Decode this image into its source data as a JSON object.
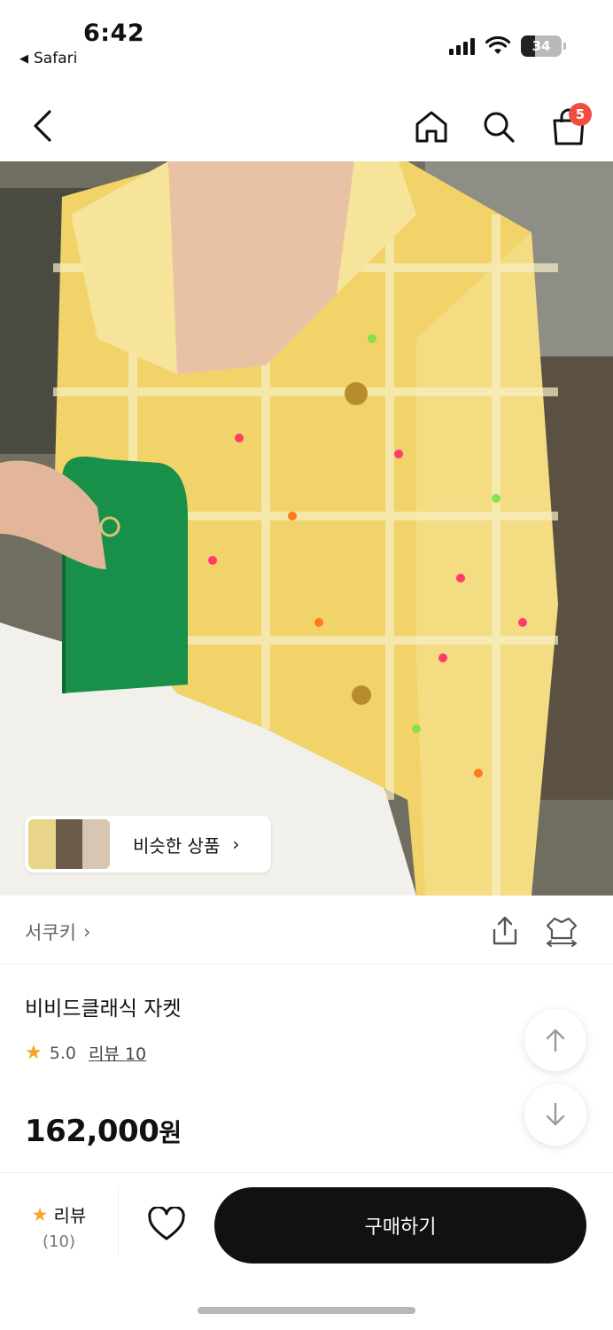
{
  "status_bar": {
    "time": "6:42",
    "back_app": "Safari",
    "battery": "34"
  },
  "nav": {
    "cart_count": "5"
  },
  "hero": {
    "similar_label": "비슷한 상품",
    "similar_arrow": "›"
  },
  "brand": {
    "name": "서쿠키",
    "arrow": "›"
  },
  "product": {
    "title": "비비드클래식 자켓",
    "rating": "5.0",
    "review_link": "리뷰 10",
    "price": "162,000",
    "currency": "원"
  },
  "bottom_bar": {
    "review_label": "리뷰",
    "review_count": "(10)",
    "buy_label": "구매하기"
  },
  "colors": {
    "accent_star": "#f6a524",
    "badge": "#f04d3f",
    "buy_button": "#111111"
  },
  "icons": [
    "back-arrow-icon",
    "home-icon",
    "search-icon",
    "shopping-bag-icon",
    "share-icon",
    "fitting-icon",
    "star-icon",
    "arrow-up-icon",
    "arrow-down-icon",
    "heart-icon"
  ]
}
